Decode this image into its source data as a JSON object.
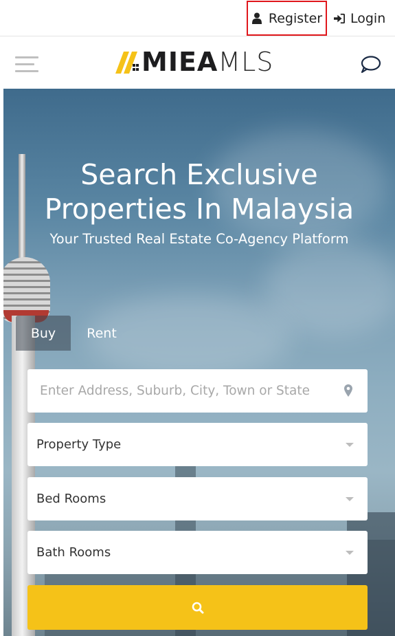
{
  "topbar": {
    "register_label": "Register",
    "login_label": "Login",
    "icons": {
      "register": "user-icon",
      "login": "sign-in-icon"
    }
  },
  "header": {
    "logo_bold": "MIEA",
    "logo_light": "MLS",
    "icons": {
      "menu": "hamburger-menu-icon",
      "chat": "chat-bubble-icon",
      "logo": "logo-mark-icon"
    }
  },
  "hero": {
    "title_line1": "Search Exclusive",
    "title_line2": "Properties In Malaysia",
    "subtitle": "Your Trusted Real Estate Co-Agency Platform"
  },
  "search": {
    "tabs": [
      {
        "label": "Buy",
        "active": true
      },
      {
        "label": "Rent",
        "active": false
      }
    ],
    "address_placeholder": "Enter Address, Suburb, City, Town or State",
    "property_type": "Property Type",
    "bed_rooms": "Bed Rooms",
    "bath_rooms": "Bath Rooms",
    "icons": {
      "location": "map-pin-icon",
      "submit": "search-icon",
      "dropdown": "caret-down-icon"
    }
  },
  "colors": {
    "accent": "#f5c218",
    "highlight_border": "#e0161b",
    "text_dark": "#222222"
  }
}
